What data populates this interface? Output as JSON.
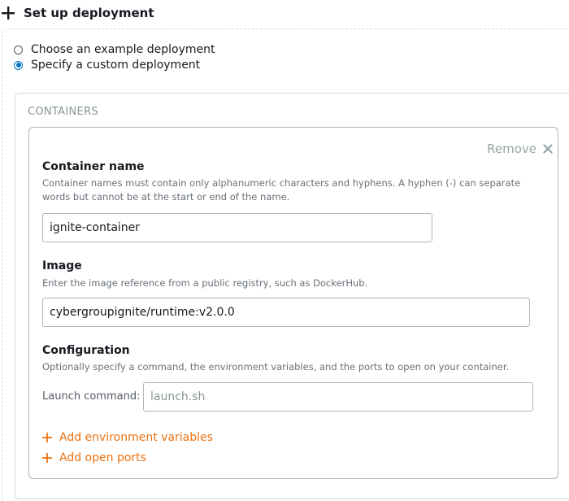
{
  "section": {
    "title": "Set up deployment"
  },
  "deployment_options": {
    "example_label": "Choose an example deployment",
    "custom_label": "Specify a custom deployment",
    "selected": "custom"
  },
  "containers": {
    "heading": "CONTAINERS",
    "card": {
      "remove_label": "Remove",
      "container_name": {
        "label": "Container name",
        "description": "Container names must contain only alphanumeric characters and hyphens. A hyphen (-) can separate words but cannot be at the start or end of the name.",
        "value": "ignite-container"
      },
      "image": {
        "label": "Image",
        "description": "Enter the image reference from a public registry, such as DockerHub.",
        "value": "cybergroupignite/runtime:v2.0.0"
      },
      "configuration": {
        "label": "Configuration",
        "description": "Optionally specify a command, the environment variables, and the ports to open on your container.",
        "launch_command_label": "Launch command:",
        "launch_command_placeholder": "launch.sh",
        "launch_command_value": ""
      },
      "add_env_label": "Add environment variables",
      "add_ports_label": "Add open ports"
    }
  },
  "colors": {
    "accent": "#ec7211",
    "radio_selected": "#0073bb",
    "muted_text": "#687078"
  }
}
